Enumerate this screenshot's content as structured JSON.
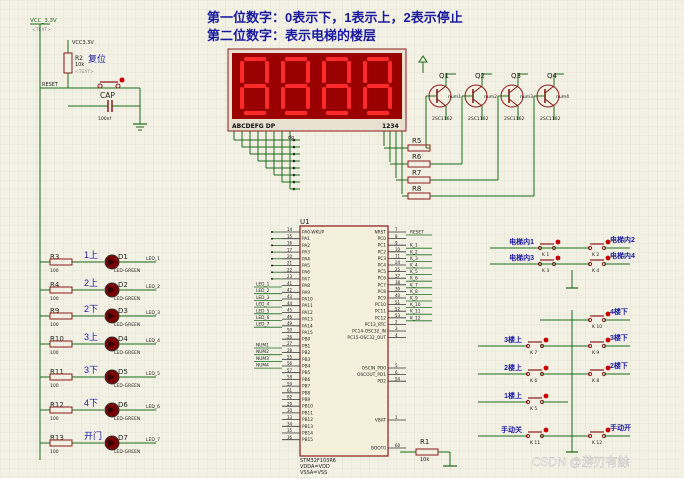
{
  "header": {
    "line1": "第一位数字：0表示下，1表示上，2表示停止",
    "line2": "第二位数字：表示电梯的楼层"
  },
  "colors": {
    "bg": "#f2f1e4",
    "grid": "#dcdccc",
    "wire": "#1a6b1a",
    "part": "#8b1a1a",
    "blue_label": "#1a1aa0",
    "seg_on": "#ff2a2a",
    "seg_bg": "#b00000",
    "led_body": "#7a0000"
  },
  "power": {
    "vcc_label": "VCC_3.3V",
    "vcc2_label": "VCC3.3V",
    "text_tag": "<TEXT>"
  },
  "reset_block": {
    "r2_name": "R2",
    "r2_val": "10k",
    "label": "复位",
    "net": "RESET",
    "cap_name": "CAP",
    "cap_val": "100nf"
  },
  "display": {
    "digits": [
      "8",
      "8",
      "8",
      "8"
    ],
    "seg_pins": "ABCDEFG DP",
    "digit_pins": "1234",
    "dp_label": "dp"
  },
  "transistors": [
    {
      "ref": "Q1",
      "model": "2SC1162",
      "net": "num1"
    },
    {
      "ref": "Q2",
      "model": "2SC1162",
      "net": "num2"
    },
    {
      "ref": "Q3",
      "model": "2SC1162",
      "net": "num3"
    },
    {
      "ref": "Q4",
      "model": "2SC1162",
      "net": "num4"
    }
  ],
  "base_resistors": [
    "R5",
    "R6",
    "R7",
    "R8"
  ],
  "mcu": {
    "ref": "U1",
    "part": "STM32F103R6",
    "pwr1": "VDDA=VDD",
    "pwr2": "VSSA=VSS",
    "left_pins": [
      {
        "num": "14",
        "name": "PA0-WKUP"
      },
      {
        "num": "15",
        "name": "PA1"
      },
      {
        "num": "16",
        "name": "PA2"
      },
      {
        "num": "17",
        "name": "PA3"
      },
      {
        "num": "20",
        "name": "PA4"
      },
      {
        "num": "21",
        "name": "PA5"
      },
      {
        "num": "22",
        "name": "PA6"
      },
      {
        "num": "23",
        "name": "PA7"
      },
      {
        "num": "41",
        "name": "PA8"
      },
      {
        "num": "42",
        "name": "PA9"
      },
      {
        "num": "43",
        "name": "PA10"
      },
      {
        "num": "44",
        "name": "PA11"
      },
      {
        "num": "45",
        "name": "PA12"
      },
      {
        "num": "46",
        "name": "PA13"
      },
      {
        "num": "49",
        "name": "PA14"
      },
      {
        "num": "50",
        "name": "PA15"
      },
      {
        "num": "26",
        "name": "PB0"
      },
      {
        "num": "27",
        "name": "PB1"
      },
      {
        "num": "28",
        "name": "PB2"
      },
      {
        "num": "55",
        "name": "PB3"
      },
      {
        "num": "56",
        "name": "PB4"
      },
      {
        "num": "57",
        "name": "PB5"
      },
      {
        "num": "58",
        "name": "PB6"
      },
      {
        "num": "59",
        "name": "PB7"
      },
      {
        "num": "61",
        "name": "PB8"
      },
      {
        "num": "62",
        "name": "PB9"
      },
      {
        "num": "29",
        "name": "PB10"
      },
      {
        "num": "30",
        "name": "PB11"
      },
      {
        "num": "33",
        "name": "PB12"
      },
      {
        "num": "34",
        "name": "PB13"
      },
      {
        "num": "35",
        "name": "PB14"
      },
      {
        "num": "36",
        "name": "PB15"
      }
    ],
    "right_pins": [
      {
        "num": "7",
        "name": "NRST"
      },
      {
        "num": "8",
        "name": "PC0"
      },
      {
        "num": "9",
        "name": "PC1"
      },
      {
        "num": "10",
        "name": "PC2"
      },
      {
        "num": "11",
        "name": "PC3"
      },
      {
        "num": "24",
        "name": "PC4"
      },
      {
        "num": "25",
        "name": "PC5"
      },
      {
        "num": "37",
        "name": "PC6"
      },
      {
        "num": "38",
        "name": "PC7"
      },
      {
        "num": "39",
        "name": "PC8"
      },
      {
        "num": "40",
        "name": "PC9"
      },
      {
        "num": "51",
        "name": "PC10"
      },
      {
        "num": "52",
        "name": "PC11"
      },
      {
        "num": "53",
        "name": "PC12"
      },
      {
        "num": "2",
        "name": "PC13_RTC"
      },
      {
        "num": "3",
        "name": "PC14-OSC32_IN"
      },
      {
        "num": "4",
        "name": "PC15-OSC32_OUT"
      },
      {
        "num": "5",
        "name": "OSCIN_PD0"
      },
      {
        "num": "6",
        "name": "OSCOUT_PD1"
      },
      {
        "num": "54",
        "name": "PD2"
      },
      {
        "num": "1",
        "name": "VBAT"
      },
      {
        "num": "60",
        "name": "BOOT0"
      }
    ],
    "left_nets": [
      "LED_1",
      "LED_2",
      "LED_3",
      "LED_4",
      "LED_5",
      "LED_6",
      "LED_7",
      "NUM1",
      "NUM2",
      "NUM3",
      "NUM4"
    ],
    "right_nets": [
      "RESET",
      "K_1",
      "K_2",
      "K_3",
      "K_4",
      "K_5",
      "K_6",
      "K_7",
      "K_8",
      "K_9",
      "K_10",
      "K_11",
      "K_12"
    ],
    "r1": {
      "ref": "R1",
      "val": "10k"
    }
  },
  "leds": [
    {
      "r": "R3",
      "val": "100",
      "label": "1上",
      "d": "D1",
      "net": "LED_1"
    },
    {
      "r": "R4",
      "val": "100",
      "label": "2上",
      "d": "D2",
      "net": "LED_2"
    },
    {
      "r": "R9",
      "val": "100",
      "label": "2下",
      "d": "D3",
      "net": "LED_3"
    },
    {
      "r": "R10",
      "val": "100",
      "label": "3上",
      "d": "D4",
      "net": "LED_4"
    },
    {
      "r": "R11",
      "val": "100",
      "label": "3下",
      "d": "D5",
      "net": "LED_5"
    },
    {
      "r": "R12",
      "val": "100",
      "label": "4下",
      "d": "D6",
      "net": "LED_6"
    },
    {
      "r": "R13",
      "val": "100",
      "label": "开门",
      "d": "D7",
      "net": "LED_7"
    }
  ],
  "led_model": "LED-GREEN",
  "buttons_inside": [
    {
      "label": "电梯内1",
      "k": "K 1"
    },
    {
      "label": "电梯内2",
      "k": "K 2"
    },
    {
      "label": "电梯内3",
      "k": "K 3"
    },
    {
      "label": "电梯内4",
      "k": "K 4"
    }
  ],
  "buttons_floor": [
    {
      "label": "4楼下",
      "k": "K 10"
    },
    {
      "label": "3楼上",
      "k": "K 7"
    },
    {
      "label": "3楼下",
      "k": "K 9"
    },
    {
      "label": "2楼上",
      "k": "K 6"
    },
    {
      "label": "2楼下",
      "k": "K 8"
    },
    {
      "label": "1楼上",
      "k": "K 5"
    },
    {
      "label": "手动关",
      "k": "K 11"
    },
    {
      "label": "手动开",
      "k": "K 12"
    }
  ],
  "watermark": "CSDN @游刃有餘"
}
